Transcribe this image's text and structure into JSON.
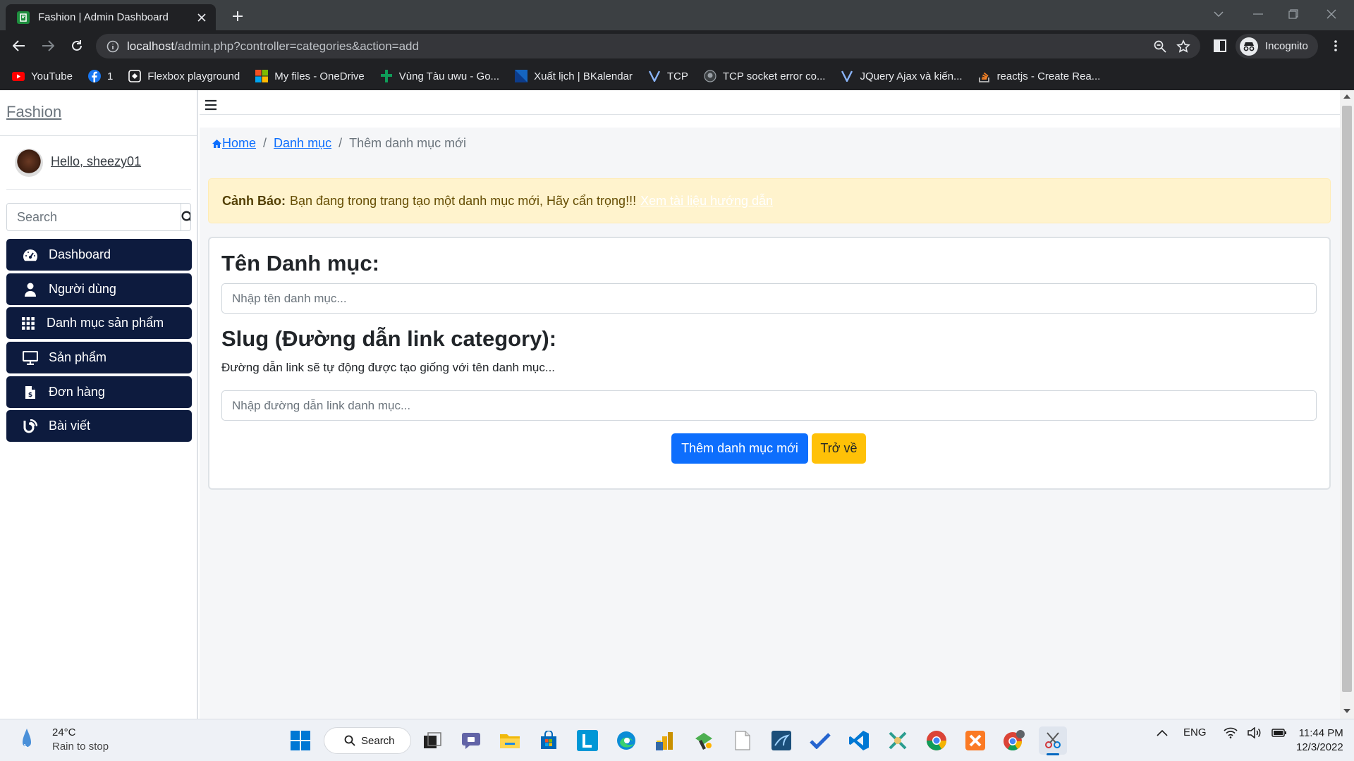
{
  "browser": {
    "tab_title": "Fashion | Admin Dashboard",
    "url_host": "localhost",
    "url_path": "/admin.php?controller=categories&action=add",
    "profile_label": "Incognito",
    "bookmarks": [
      {
        "label": "YouTube",
        "icon": "youtube-icon",
        "color": "#ff0000"
      },
      {
        "label": "1",
        "icon": "facebook-icon",
        "color": "#1877f2"
      },
      {
        "label": "Flexbox playground",
        "icon": "flexbox-icon",
        "color": "#ffffff"
      },
      {
        "label": "My files - OneDrive",
        "icon": "microsoft-icon",
        "color": "#f25022"
      },
      {
        "label": "Vùng Tàu uwu - Go...",
        "icon": "google-sheets-icon",
        "color": "#0f9d58"
      },
      {
        "label": "Xuất lịch | BKalendar",
        "icon": "bkalendar-icon",
        "color": "#1565c0"
      },
      {
        "label": "TCP",
        "icon": "v-icon",
        "color": "#8ab4f8"
      },
      {
        "label": "TCP socket error co...",
        "icon": "github-icon",
        "color": "#9aa0a6"
      },
      {
        "label": "JQuery Ajax và kiến...",
        "icon": "v-icon",
        "color": "#8ab4f8"
      },
      {
        "label": "reactjs - Create Rea...",
        "icon": "stackoverflow-icon",
        "color": "#f48024"
      }
    ]
  },
  "sidebar": {
    "brand": "Fashion",
    "greeting": "Hello, sheezy01",
    "search_placeholder": "Search",
    "items": [
      {
        "label": "Dashboard",
        "icon": "speedometer-icon"
      },
      {
        "label": "Người dùng",
        "icon": "user-icon"
      },
      {
        "label": "Danh mục sản phẩm",
        "icon": "grid-icon"
      },
      {
        "label": "Sản phẩm",
        "icon": "monitor-icon"
      },
      {
        "label": "Đơn hàng",
        "icon": "invoice-icon"
      },
      {
        "label": "Bài viết",
        "icon": "blog-icon"
      }
    ]
  },
  "breadcrumb": {
    "home": "Home",
    "category": "Danh mục",
    "current": "Thêm danh mục mới"
  },
  "alert": {
    "title": "Cảnh Báo:",
    "message": "Bạn đang trong trang tạo một danh mục mới, Hãy cẩn trọng!!!",
    "link": "Xem tài liệu hướng dẫn"
  },
  "form": {
    "name_label": "Tên Danh mục:",
    "name_placeholder": "Nhập tên danh mục...",
    "slug_label": "Slug (Đường dẫn link category):",
    "slug_hint": "Đường dẫn link sẽ tự động được tạo giống với tên danh mục...",
    "slug_placeholder": "Nhập đường dẫn link danh mục...",
    "submit_label": "Thêm danh mục mới",
    "back_label": "Trở về"
  },
  "colors": {
    "primary": "#0d6efd",
    "warning": "#ffc107",
    "sidebar_item": "#0d1b3e",
    "alert_bg": "#fff3cd"
  },
  "taskbar": {
    "weather_temp": "24°C",
    "weather_desc": "Rain to stop",
    "search_label": "Search",
    "language": "ENG",
    "time": "11:44 PM",
    "date": "12/3/2022"
  }
}
